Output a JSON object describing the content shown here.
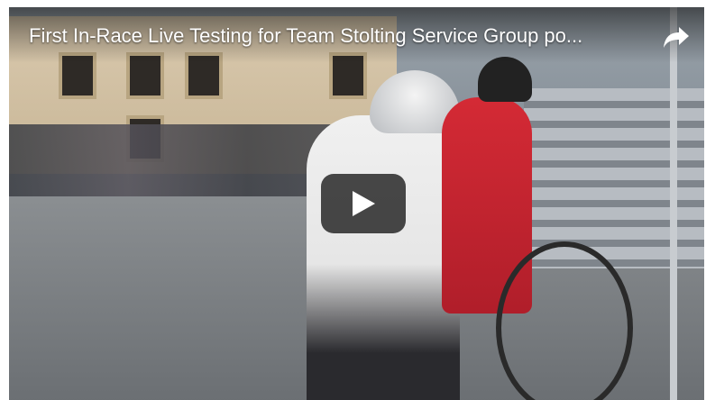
{
  "video": {
    "title": "First In-Race Live Testing for Team Stolting Service Group po..."
  },
  "icons": {
    "share": "share-icon",
    "play": "play-icon"
  },
  "colors": {
    "overlay_text": "#ffffff",
    "play_button_bg": "#212121"
  }
}
